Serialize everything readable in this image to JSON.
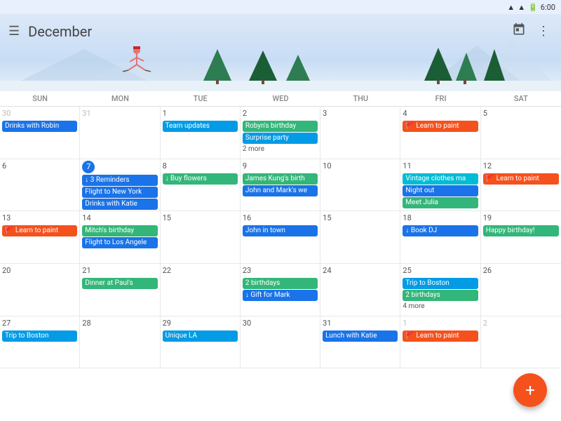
{
  "statusBar": {
    "time": "6:00",
    "icons": [
      "wifi",
      "signal",
      "battery"
    ]
  },
  "header": {
    "menuLabel": "☰",
    "monthTitle": "December",
    "calendarIconLabel": "📅",
    "moreIconLabel": "⋮"
  },
  "dayHeaders": [
    "Sun",
    "Mon",
    "Tue",
    "Wed",
    "Thu",
    "Fri",
    "Sat"
  ],
  "weeks": [
    {
      "days": [
        {
          "num": "30",
          "otherMonth": true,
          "events": [
            {
              "label": "Drinks with Robin",
              "color": "blue"
            }
          ]
        },
        {
          "num": "31",
          "otherMonth": true,
          "events": []
        },
        {
          "num": "1",
          "events": [
            {
              "label": "Team updates",
              "color": "teal"
            }
          ]
        },
        {
          "num": "2",
          "events": [
            {
              "label": "Robyn's birthday",
              "color": "green"
            },
            {
              "label": "Surprise party",
              "color": "teal"
            }
          ],
          "more": "2 more"
        },
        {
          "num": "3",
          "events": []
        },
        {
          "num": "4",
          "events": [
            {
              "label": "🚩 Learn to paint",
              "color": "orange"
            }
          ]
        },
        {
          "num": "5",
          "events": []
        }
      ]
    },
    {
      "days": [
        {
          "num": "6",
          "events": []
        },
        {
          "num": "7",
          "today": true,
          "events": [
            {
              "label": "↓ 3 Reminders",
              "color": "blue"
            },
            {
              "label": "Flight to New York",
              "color": "blue"
            },
            {
              "label": "Drinks with Katie",
              "color": "blue"
            }
          ]
        },
        {
          "num": "8",
          "events": [
            {
              "label": "↓ Buy flowers",
              "color": "green"
            }
          ]
        },
        {
          "num": "9",
          "events": [
            {
              "label": "James Kung's birth",
              "color": "green"
            },
            {
              "label": "John and Mark's we",
              "color": "blue"
            }
          ]
        },
        {
          "num": "10",
          "events": []
        },
        {
          "num": "11",
          "events": [
            {
              "label": "Vintage clothes ma",
              "color": "cyan"
            },
            {
              "label": "Night out",
              "color": "blue"
            },
            {
              "label": "Meet Julia",
              "color": "green"
            }
          ]
        },
        {
          "num": "12",
          "events": [
            {
              "label": "🚩 Learn to paint",
              "color": "orange"
            }
          ]
        }
      ]
    },
    {
      "days": [
        {
          "num": "13",
          "events": [
            {
              "label": "🚩 Learn to paint",
              "color": "orange"
            }
          ]
        },
        {
          "num": "14",
          "events": [
            {
              "label": "Mitch's birthday",
              "color": "green"
            },
            {
              "label": "Flight to Los Angele",
              "color": "blue"
            }
          ]
        },
        {
          "num": "15",
          "events": []
        },
        {
          "num": "16",
          "events": [
            {
              "label": "John in town",
              "color": "blue"
            }
          ]
        },
        {
          "num": "15",
          "events": []
        },
        {
          "num": "18",
          "events": [
            {
              "label": "↓ Book DJ",
              "color": "blue"
            }
          ]
        },
        {
          "num": "19",
          "events": [
            {
              "label": "Happy birthday!",
              "color": "green"
            }
          ]
        }
      ]
    },
    {
      "days": [
        {
          "num": "20",
          "events": []
        },
        {
          "num": "21",
          "events": [
            {
              "label": "Dinner at Paul's",
              "color": "green"
            }
          ]
        },
        {
          "num": "22",
          "events": []
        },
        {
          "num": "23",
          "events": [
            {
              "label": "2 birthdays",
              "color": "green"
            },
            {
              "label": "↓ Gift for Mark",
              "color": "blue"
            }
          ]
        },
        {
          "num": "24",
          "events": []
        },
        {
          "num": "25",
          "events": [
            {
              "label": "Trip to Boston",
              "color": "teal"
            },
            {
              "label": "2 birthdays",
              "color": "green"
            }
          ],
          "more": "4 more"
        },
        {
          "num": "26",
          "events": []
        }
      ]
    },
    {
      "days": [
        {
          "num": "27",
          "events": [
            {
              "label": "Trip to Boston",
              "color": "teal"
            }
          ]
        },
        {
          "num": "28",
          "events": []
        },
        {
          "num": "29",
          "events": [
            {
              "label": "Unique LA",
              "color": "teal"
            }
          ]
        },
        {
          "num": "30",
          "events": []
        },
        {
          "num": "31",
          "events": [
            {
              "label": "Lunch with Katie",
              "color": "blue"
            }
          ]
        },
        {
          "num": "1",
          "otherMonth": true,
          "events": [
            {
              "label": "🚩 Learn to paint",
              "color": "orange"
            }
          ]
        },
        {
          "num": "2",
          "otherMonth": true,
          "events": []
        }
      ]
    }
  ],
  "fab": {
    "label": "+"
  }
}
